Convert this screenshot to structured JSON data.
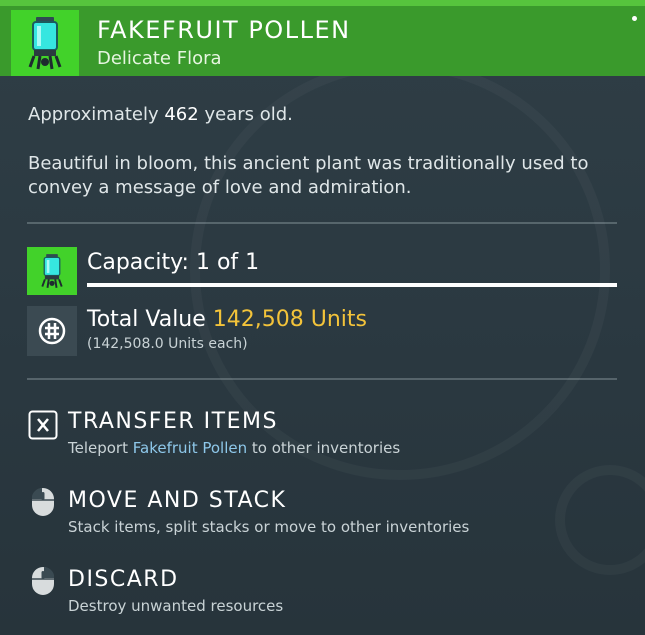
{
  "header": {
    "title": "FAKEFRUIT POLLEN",
    "subtitle": "Delicate Flora",
    "icon": "pollen-canister-icon",
    "color": "#3a9a2c"
  },
  "info": {
    "age_prefix": "Approximately ",
    "age_value": "462",
    "age_suffix": " years old.",
    "description": "Beautiful in bloom, this ancient plant was traditionally used to convey a message of love and admiration."
  },
  "capacity": {
    "label": "Capacity: 1 of 1",
    "fill_fraction": 1.0
  },
  "value": {
    "label": "Total Value ",
    "amount": "142,508 Units",
    "each": "(142,508.0 Units each)",
    "amount_color": "#f3c33a"
  },
  "actions": [
    {
      "icon": "x-key-icon",
      "label": "TRANSFER ITEMS",
      "desc_prefix": "Teleport ",
      "desc_highlight": "Fakefruit Pollen",
      "desc_suffix": " to other inventories"
    },
    {
      "icon": "mouse-left-click-icon",
      "label": "MOVE AND STACK",
      "desc": "Stack items, split stacks or move to other inventories"
    },
    {
      "icon": "mouse-right-click-icon",
      "label": "DISCARD",
      "desc": "Destroy unwanted resources"
    }
  ]
}
